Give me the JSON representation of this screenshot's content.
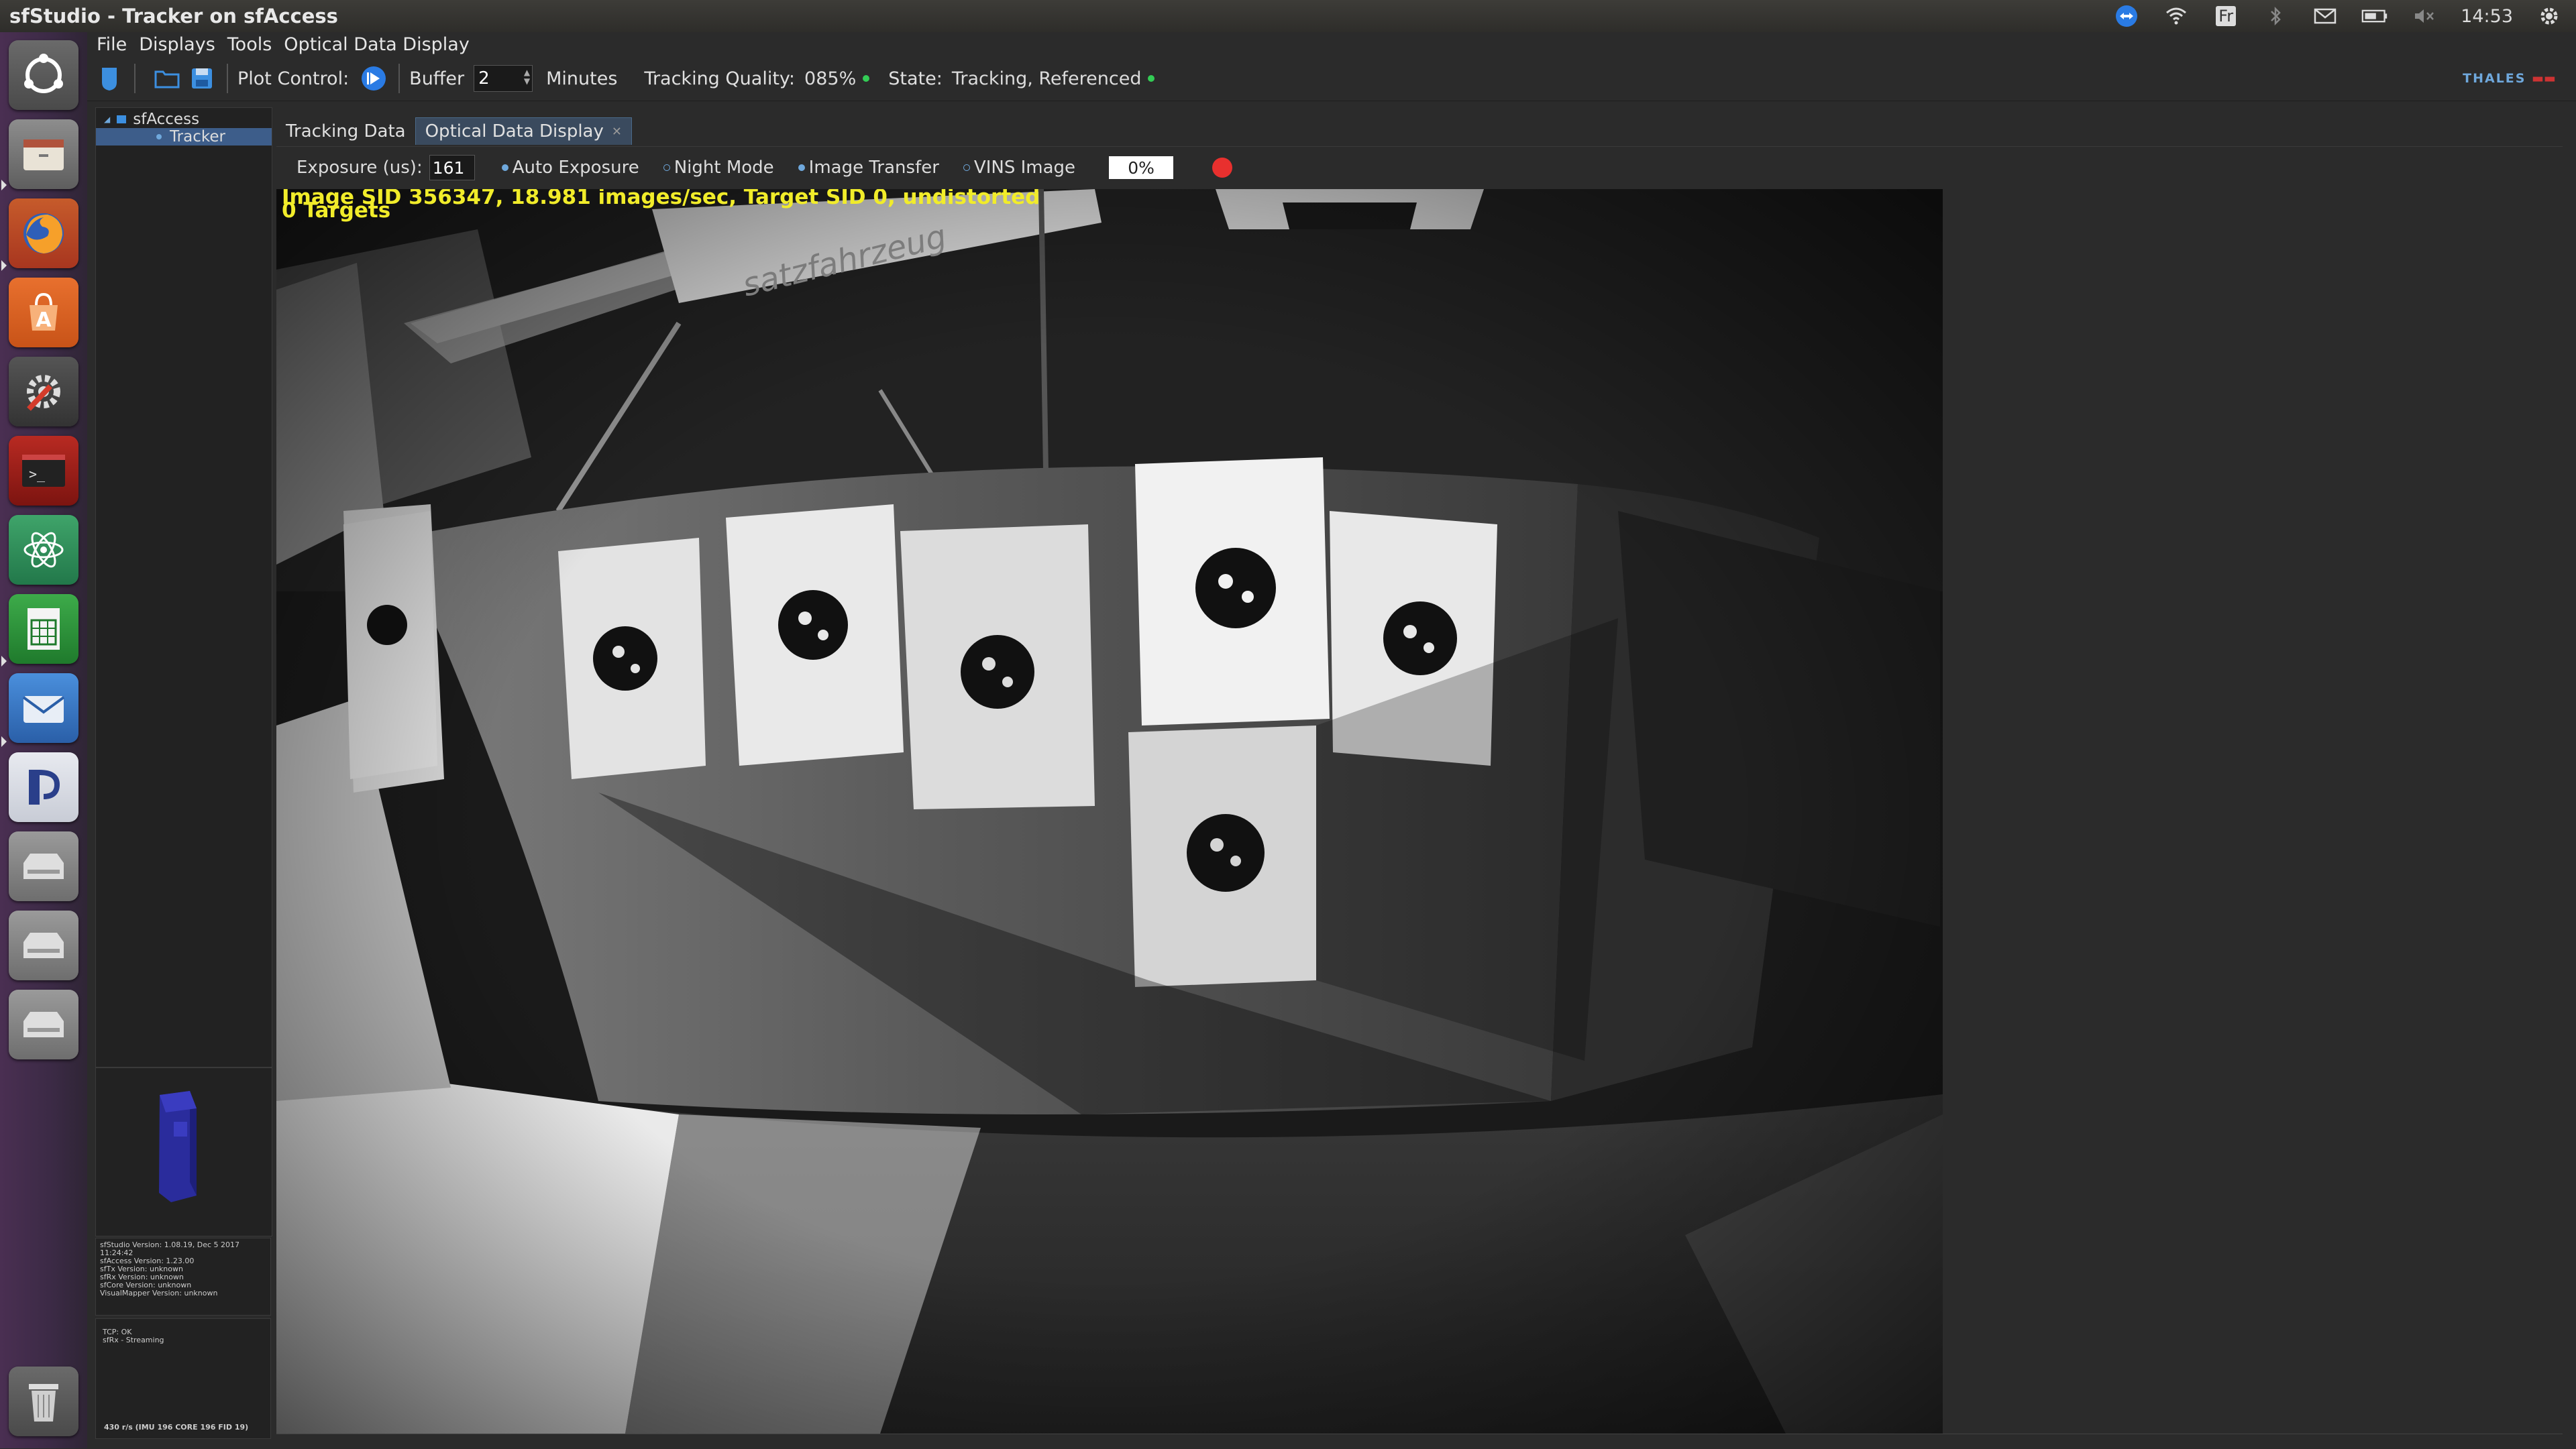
{
  "window": {
    "title": "sfStudio - Tracker on sfAccess"
  },
  "indicators": {
    "time": "14:53",
    "keyboard": "Fr"
  },
  "menu": [
    "File",
    "Displays",
    "Tools",
    "Optical Data Display"
  ],
  "toolbar": {
    "plot_control_label": "Plot Control:",
    "buffer_label": "Buffer",
    "buffer_value": "2",
    "minutes_label": "Minutes",
    "tracking_quality_label": "Tracking Quality:",
    "tracking_quality_value": "085%",
    "state_label": "State:",
    "state_value": "Tracking, Referenced",
    "brand": "THALES"
  },
  "tree": {
    "root": "sfAccess",
    "child": "Tracker"
  },
  "tabs": [
    {
      "label": "Tracking Data"
    },
    {
      "label": "Optical Data Display"
    }
  ],
  "controls": {
    "exposure_label": "Exposure (us):",
    "exposure_value": "161",
    "auto_exposure": "Auto Exposure",
    "night_mode": "Night Mode",
    "image_transfer": "Image Transfer",
    "vins_image": "VINS Image",
    "progress": "0%"
  },
  "image": {
    "overlay_line1": "Image SID 356347, 18.981 images/sec, Target SID 0, undistorted",
    "overlay_line2": "0 Targets",
    "banner_text": "satzfahrzeug"
  },
  "info": {
    "lines": [
      "sfStudio Version: 1.08.19, Dec 5 2017",
      "11:24:42",
      "sfAccess Version: 1.23.00",
      "sfTx Version: unknown",
      "sfRx Version: unknown",
      "sfCore Version: unknown",
      "VisualMapper Version: unknown"
    ]
  },
  "status": {
    "lines": [
      "TCP: OK",
      "sfRx - Streaming"
    ],
    "footer": "430 r/s (IMU 196  CORE 196  FID 19)"
  },
  "colors": {
    "accent": "#3d5d8a",
    "overlay": "#f1ec2a",
    "record": "#e8302e"
  }
}
